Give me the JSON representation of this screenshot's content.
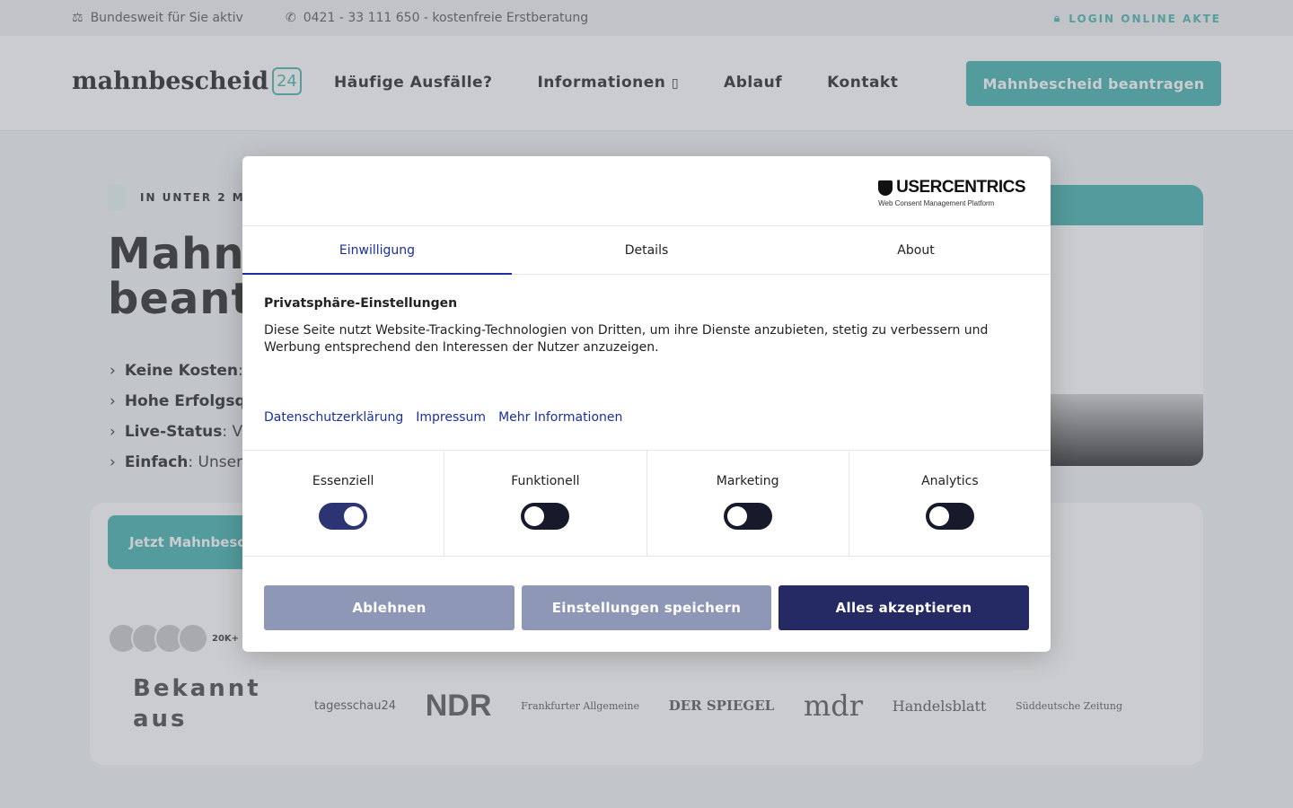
{
  "topbar": {
    "nationwide": "Bundesweit für Sie aktiv",
    "phone": "0421 - 33 111 650 - kostenfreie Erstberatung",
    "login": "LOGIN ONLINE AKTE"
  },
  "header": {
    "logo_text": "mahnbescheid",
    "logo_badge": "24",
    "nav": [
      "Häufige Ausfälle?",
      "Informationen",
      "Ablauf",
      "Kontakt"
    ],
    "cta": "Mahnbescheid beantragen"
  },
  "hero": {
    "badge": "IN UNTER 2 M",
    "title_line1": "Mahn",
    "title_line2": "beant",
    "bullets": [
      {
        "bold": "Keine Kosten",
        "rest": ":"
      },
      {
        "bold": "Hohe Erfolgsq",
        "rest": ""
      },
      {
        "bold": "Live-Status",
        "rest": ": V"
      },
      {
        "bold": "Einfach",
        "rest": ": Unser"
      }
    ],
    "cta": "Jetzt Mahnbesch",
    "avatar_count": "20K+",
    "known_from": "Bekannt aus",
    "press": [
      "tagesschau24",
      "NDR",
      "Frankfurter Allgemeine",
      "DER SPIEGEL",
      "mdr",
      "Handelsblatt",
      "Süddeutsche Zeitung"
    ]
  },
  "consent": {
    "brand": "USERCENTRICS",
    "brand_sub": "Web Consent Management Platform",
    "tabs": [
      "Einwilligung",
      "Details",
      "About"
    ],
    "active_tab": 0,
    "title": "Privatsphäre-Einstellungen",
    "text": "Diese Seite nutzt Website-Tracking-Technologien von Dritten, um ihre Dienste anzubieten, stetig zu verbessern und Werbung entsprechend den Interessen der Nutzer anzuzeigen.",
    "links": [
      "Datenschutzerklärung",
      "Impressum",
      "Mehr Informationen"
    ],
    "categories": [
      {
        "label": "Essenziell",
        "enabled": true
      },
      {
        "label": "Funktionell",
        "enabled": false
      },
      {
        "label": "Marketing",
        "enabled": false
      },
      {
        "label": "Analytics",
        "enabled": false
      }
    ],
    "buttons": {
      "deny": "Ablehnen",
      "save": "Einstellungen speichern",
      "accept": "Alles akzeptieren"
    }
  },
  "colors": {
    "teal": "#3fb1ad",
    "consent_blue": "#1a2fa0",
    "accept_navy": "#252a65",
    "secondary_btn": "#8e98b6"
  }
}
